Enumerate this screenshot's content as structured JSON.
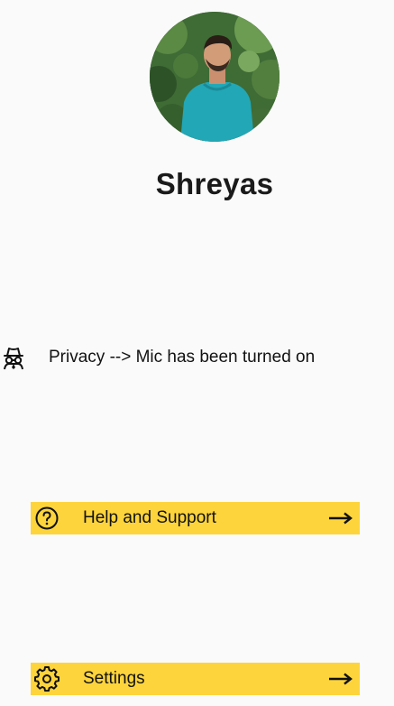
{
  "profile": {
    "name": "Shreyas"
  },
  "privacy": {
    "icon": "incognito-icon",
    "text": "Privacy --> Mic has been turned on"
  },
  "actions": [
    {
      "label": "Help and Support",
      "icon": "help-circle-icon",
      "trailing_icon": "arrow-right-icon"
    },
    {
      "label": "Settings",
      "icon": "gear-icon",
      "trailing_icon": "arrow-right-icon"
    }
  ],
  "colors": {
    "background": "#fafafa",
    "action_bar": "#fdd43c",
    "text": "#111111"
  }
}
